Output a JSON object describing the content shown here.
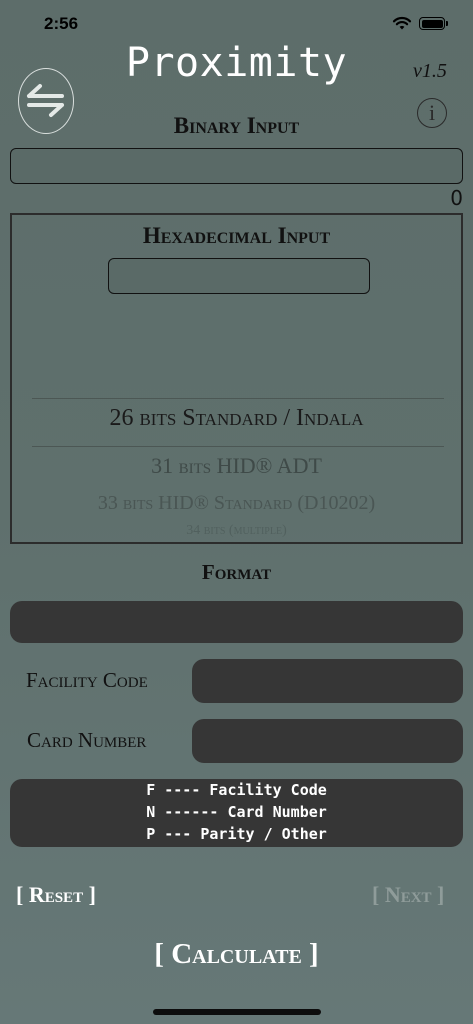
{
  "status_bar": {
    "time": "2:56"
  },
  "header": {
    "title": "Proximity",
    "version": "v1.5",
    "info_glyph": "i"
  },
  "binary": {
    "label": "Binary Input",
    "value": "",
    "count": "0"
  },
  "hex": {
    "label": "Hexadecimal Input",
    "value": "",
    "formats": [
      "26 bits Standard / Indala",
      "31 bits HID® ADT",
      "33 bits HID® Standard (D10202)",
      "34 bits (multiple)"
    ]
  },
  "format": {
    "label": "Format",
    "value": ""
  },
  "facility": {
    "label": "Facility Code",
    "value": ""
  },
  "card": {
    "label": "Card Number",
    "value": ""
  },
  "legend": {
    "lines": [
      "F ---- Facility Code",
      "N ------ Card Number",
      "P --- Parity / Other"
    ]
  },
  "actions": {
    "reset": "[ Reset ]",
    "next": "[ Next ]",
    "calculate": "[ Calculate ]"
  },
  "icons": {
    "swap": "swap-arrows-icon",
    "info": "info-icon",
    "wifi": "wifi-icon",
    "battery": "battery-icon"
  },
  "colors": {
    "field_bg": "#363636",
    "text_light": "#ffffff",
    "disabled": "#8f9c9a"
  }
}
